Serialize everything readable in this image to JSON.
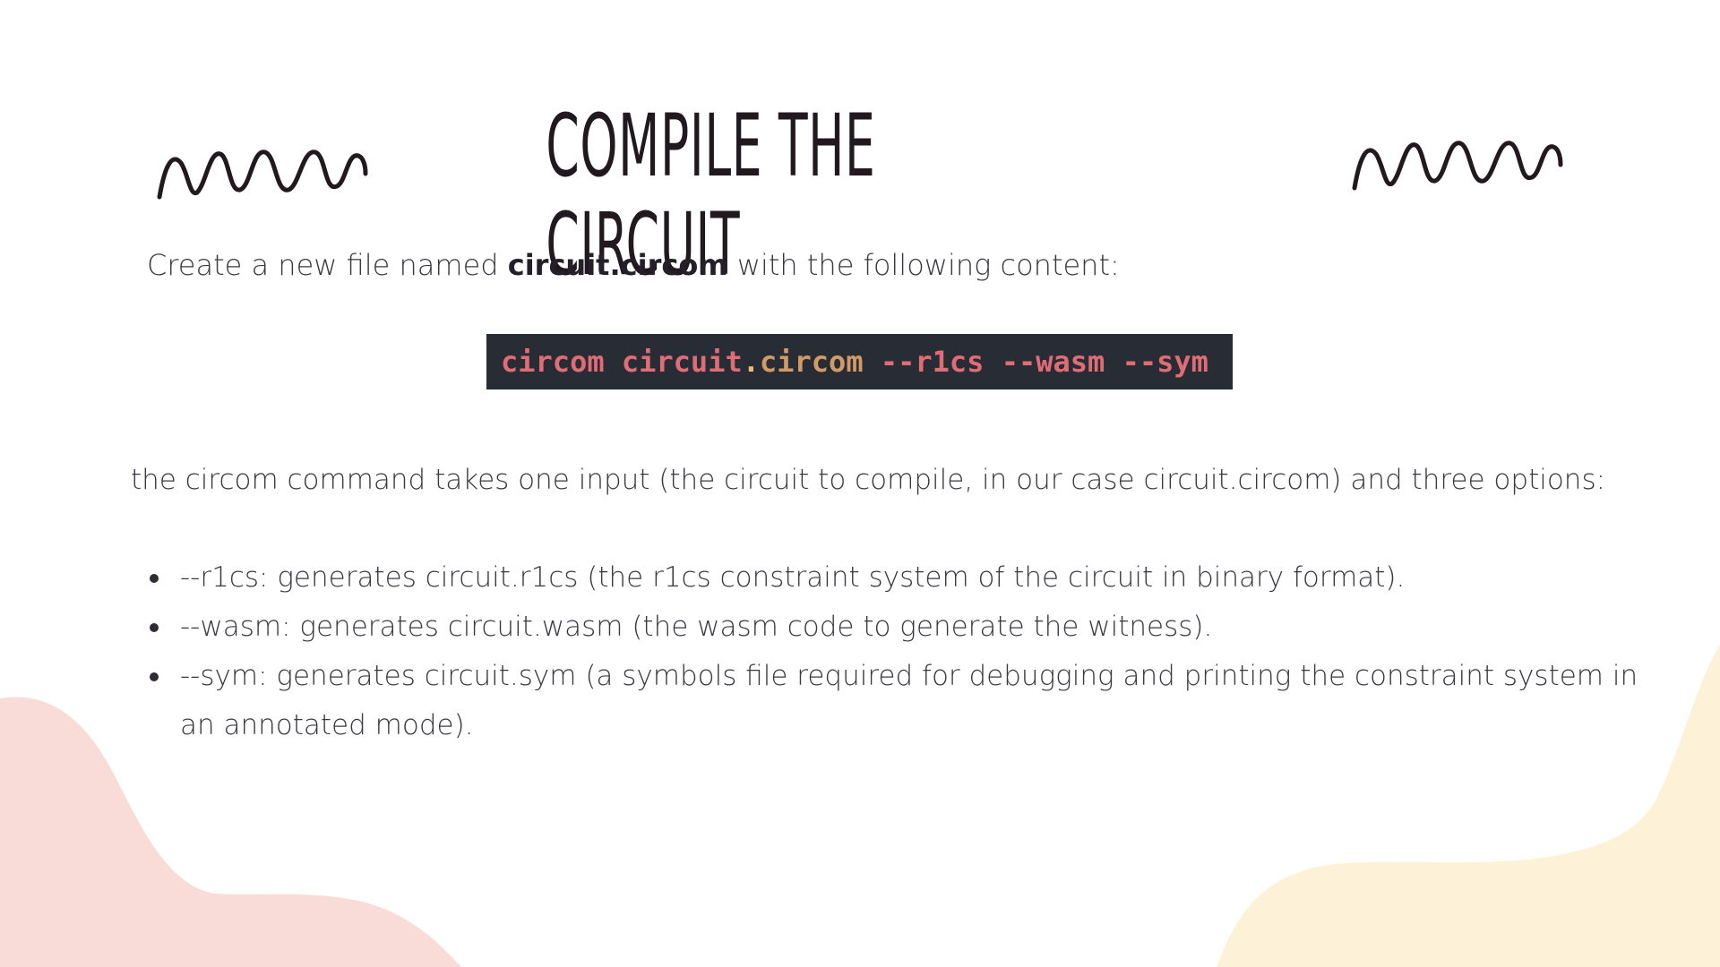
{
  "slide": {
    "title": "COMPILE THE CIRCUIT",
    "intro": {
      "before": "Create a new file named ",
      "filename": "circuit.circom",
      "after": " with the following content:"
    },
    "code": {
      "part1": "circom circuit",
      "dot": ".",
      "part2": "circom",
      "part3": " --r1cs --wasm --sym"
    },
    "paragraph": "the circom command takes one input (the circuit to compile, in our case circuit.circom) and three options:",
    "options": [
      "--r1cs: generates circuit.r1cs (the r1cs constraint system of the circuit in binary format).",
      "--wasm: generates circuit.wasm (the wasm code to generate the witness).",
      "--sym: generates circuit.sym (a symbols file required for debugging and printing the constraint system in an annotated mode)."
    ]
  },
  "colors": {
    "background": "#ffffff",
    "text": "#3b3742",
    "title": "#22191f",
    "code_background": "#282c34",
    "code_red": "#e06c75",
    "code_orange": "#d19a66",
    "blob_pink": "#f9dcd8",
    "blob_yellow": "#fdf1d8"
  },
  "icons": [
    "squiggle-left-icon",
    "squiggle-right-icon"
  ]
}
